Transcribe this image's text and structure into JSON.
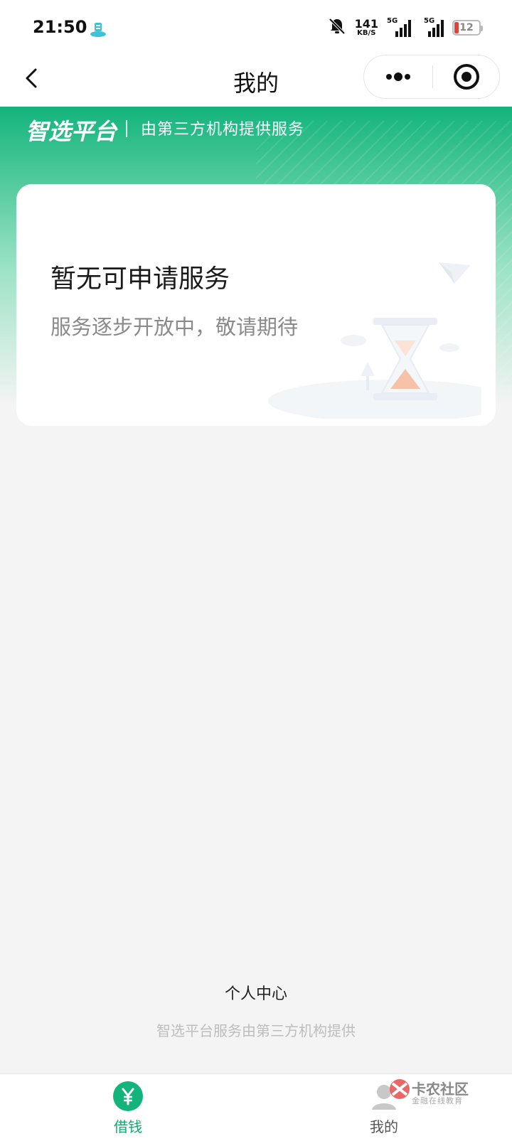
{
  "status_bar": {
    "time": "21:50",
    "net_speed_value": "141",
    "net_speed_unit": "KB/S",
    "signal_1_label": "5G",
    "signal_2_label": "5G",
    "battery_level": "12"
  },
  "navbar": {
    "title": "我的"
  },
  "banner": {
    "brand": "智选平台",
    "subtitle": "由第三方机构提供服务"
  },
  "empty_card": {
    "title": "暂无可申请服务",
    "subtitle": "服务逐步开放中，敬请期待"
  },
  "footer": {
    "title": "个人中心",
    "note": "智选平台服务由第三方机构提供"
  },
  "tabbar": {
    "items": [
      {
        "label": "借钱",
        "icon": "yen-circle-icon",
        "active": true
      },
      {
        "label": "我的",
        "icon": "user-icon",
        "active": false
      }
    ]
  },
  "watermark": {
    "name": "卡农社区",
    "tagline": "金融在线教育"
  },
  "colors": {
    "brand_green": "#13b47c",
    "active_tab": "#13a96f",
    "battery_low": "#e0433a"
  }
}
